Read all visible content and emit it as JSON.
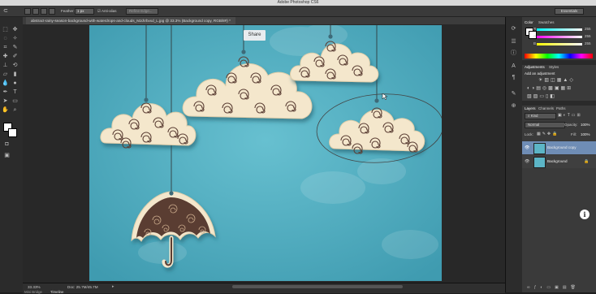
{
  "app": {
    "title": "Adobe Photoshop CS6",
    "workspace": "Essentials"
  },
  "options_bar": {
    "feather_label": "Feather:",
    "feather_value": "1 px",
    "anti_alias_label": "Anti-alias",
    "refine_edge_label": "Refine Edge..."
  },
  "document": {
    "tab_label": "abstract-rainy-season-background-with-waterdrops-and-clouds_MJdVbvxd_L.jpg @ 33.3% (Background copy, RGB/8#) *",
    "zoom": "33.33%",
    "doc_size": "Doc: 25.7M/45.7M"
  },
  "overlay": {
    "share_label": "Share",
    "info_label": "i"
  },
  "color_panel": {
    "tabs": [
      "Color",
      "Swatches"
    ],
    "r": "255",
    "g": "255",
    "b": "255",
    "r_label": "R",
    "g_label": "G",
    "b_label": "B"
  },
  "adjustments_panel": {
    "tabs": [
      "Adjustments",
      "Styles"
    ],
    "add_label": "Add an adjustment"
  },
  "layers_panel": {
    "tabs": [
      "Layers",
      "Channels",
      "Paths"
    ],
    "kind_label": "Kind",
    "blend_mode": "Normal",
    "opacity_label": "Opacity:",
    "opacity_value": "100%",
    "lock_label": "Lock:",
    "fill_label": "Fill:",
    "fill_value": "100%",
    "layers": [
      {
        "name": "Background copy",
        "selected": true
      },
      {
        "name": "Background",
        "selected": false
      }
    ]
  },
  "bottom_tabs": [
    "Mini Bridge",
    "Timeline"
  ],
  "colors": {
    "canvas": "#5cb5c6",
    "cloud": "#f4e7cc",
    "umbrella": "#5a3d33"
  }
}
